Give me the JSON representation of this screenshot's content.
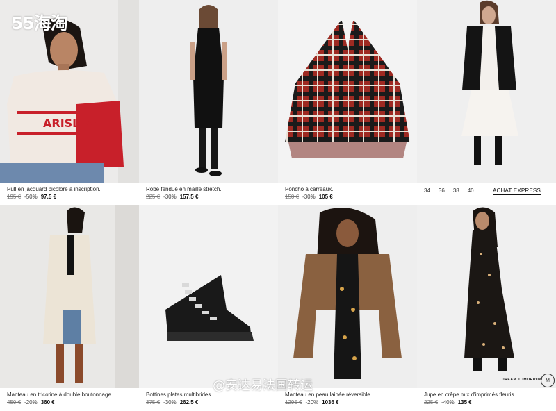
{
  "overlay": {
    "logo_text": "55海淘",
    "watermark_text": "@安达易法国转运"
  },
  "products": [
    {
      "name": "Pull en jacquard bicolore à inscription.",
      "old_price": "195 €",
      "discount": "-50%",
      "price": "97.5 €",
      "image_text": "ARISLAWIT"
    },
    {
      "name": "Robe fendue en maille stretch.",
      "old_price": "225 €",
      "discount": "-30%",
      "price": "157.5 €"
    },
    {
      "name": "Poncho à carreaux.",
      "old_price": "150 €",
      "discount": "-30%",
      "price": "105 €"
    },
    {
      "name": "Manteau en tricotine à double boutonnage.",
      "old_price": "450 €",
      "discount": "-20%",
      "price": "360 €"
    },
    {
      "name": "Bottines plates multibrides.",
      "old_price": "375 €",
      "discount": "-30%",
      "price": "262.5 €"
    },
    {
      "name": "Manteau en peau lainée réversible.",
      "old_price": "1295 €",
      "discount": "-20%",
      "price": "1036 €"
    },
    {
      "name": "Jupe en crêpe mix d'imprimés fleuris.",
      "old_price": "225 €",
      "discount": "-40%",
      "price": "135 €"
    }
  ],
  "hover_card": {
    "sizes": [
      "34",
      "36",
      "38",
      "40"
    ],
    "express_label": "ACHAT EXPRESS"
  },
  "brand_tag": {
    "text": "DREAM TOMORROW",
    "badge": "M"
  },
  "colors": {
    "accent_red": "#c8202a",
    "background": "#ffffff",
    "text": "#1a1a1a"
  }
}
